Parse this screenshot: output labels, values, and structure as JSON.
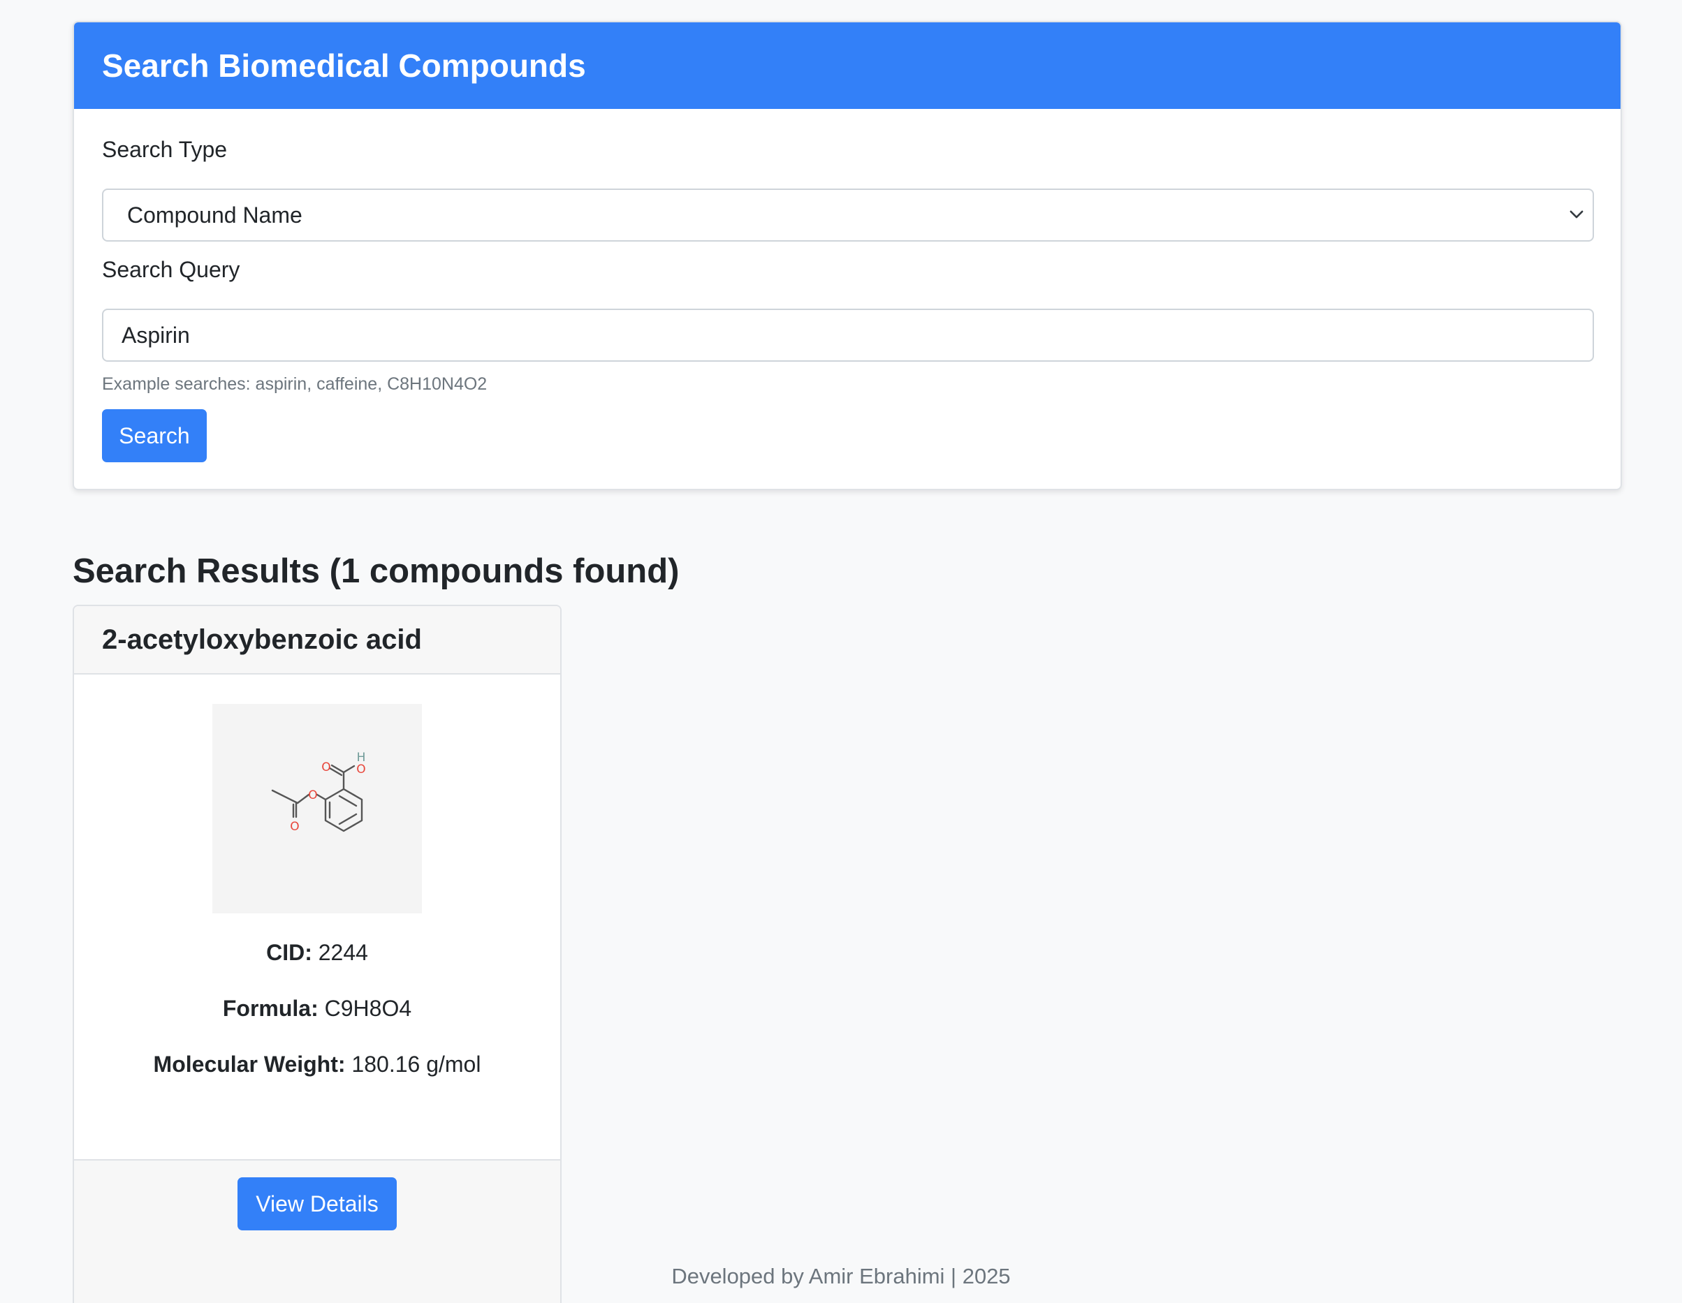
{
  "search_panel": {
    "title": "Search Biomedical Compounds",
    "search_type_label": "Search Type",
    "search_type_selected": "Compound Name",
    "search_query_label": "Search Query",
    "search_query_value": "Aspirin",
    "help_text": "Example searches: aspirin, caffeine, C8H10N4O2",
    "search_button": "Search"
  },
  "results": {
    "heading": "Search Results (1 compounds found)",
    "items": [
      {
        "name": "2-acetyloxybenzoic acid",
        "structure_atoms": [
          "O",
          "H",
          "O",
          "O",
          "O"
        ],
        "cid_label": "CID:",
        "cid": "2244",
        "formula_label": "Formula:",
        "formula": "C9H8O4",
        "mw_label": "Molecular Weight:",
        "mw": "180.16 g/mol",
        "details_button": "View Details"
      }
    ]
  },
  "footer": {
    "text": "Developed by Amir Ebrahimi | 2025"
  },
  "colors": {
    "primary": "#3380f8",
    "oxygen": "#e8463b",
    "hydrogen": "#6f9a98",
    "bond": "#555555"
  },
  "icons": {
    "select_chevron": "chevron-down-icon"
  }
}
